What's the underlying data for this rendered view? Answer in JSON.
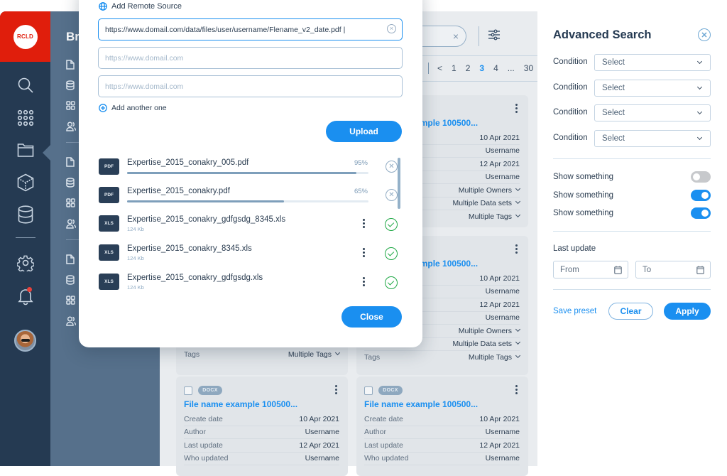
{
  "sidebar": {
    "logo_text": "RCLD",
    "items": [
      {
        "icon": "search-icon"
      },
      {
        "icon": "apps-grid-icon"
      },
      {
        "icon": "folder-icon",
        "active": true
      },
      {
        "icon": "cube-icon"
      },
      {
        "icon": "database-icon"
      },
      {
        "icon": "gear-icon"
      },
      {
        "icon": "bell-icon",
        "notification": true
      },
      {
        "icon": "avatar"
      }
    ]
  },
  "subnav": {
    "title": "Br",
    "groups": [
      [
        "file-icon",
        "database-icon",
        "grid-icon",
        "users-icon"
      ],
      [
        "file-icon",
        "database-icon",
        "grid-icon",
        "users-icon"
      ],
      [
        "file-icon",
        "database-icon",
        "grid-icon",
        "users-icon"
      ]
    ]
  },
  "toolbar": {
    "search_clear": "×",
    "pagination": {
      "prev": "<",
      "pages": [
        "1",
        "2",
        "3",
        "4",
        "...",
        "30"
      ],
      "current": "3"
    }
  },
  "cards": [
    {
      "title": "File name example 100500...",
      "badge": "",
      "rows": [
        {
          "key": "",
          "value": "10 Apr 2021"
        },
        {
          "key": "",
          "value": "Username"
        },
        {
          "key": "",
          "value": "12 Apr 2021"
        },
        {
          "key": "",
          "value": "Username"
        },
        {
          "key": "",
          "value": "Multiple Owners",
          "dropdown": true
        },
        {
          "key": "",
          "value": "Multiple Data sets",
          "dropdown": true
        },
        {
          "key": "",
          "value": "Multiple Tags",
          "dropdown": true
        }
      ]
    },
    {
      "title": "File name example 100500...",
      "badge": "",
      "rows": [
        {
          "key": "",
          "value": "10 Apr 2021"
        },
        {
          "key": "",
          "value": "Username"
        },
        {
          "key": "",
          "value": "12 Apr 2021"
        },
        {
          "key": "",
          "value": "Username"
        },
        {
          "key": "",
          "value": "Multiple Owners",
          "dropdown": true
        },
        {
          "key": "",
          "value": "Multiple Data sets",
          "dropdown": true
        },
        {
          "key": "Tags",
          "value": "Multiple Tags",
          "dropdown": true
        }
      ],
      "left_tags_row": {
        "key": "Tags",
        "value": "Multiple Tags"
      }
    },
    {
      "title": "File name example 100500...",
      "badge": "DOCX",
      "rows": [
        {
          "key": "Create date",
          "value": "10 Apr 2021"
        },
        {
          "key": "Author",
          "value": "Username"
        },
        {
          "key": "Last update",
          "value": "12 Apr 2021"
        },
        {
          "key": "Who updated",
          "value": "Username"
        }
      ]
    },
    {
      "title": "File name example 100500...",
      "badge": "DOCX",
      "rows": [
        {
          "key": "Create date",
          "value": "10 Apr 2021"
        },
        {
          "key": "Author",
          "value": "Username"
        },
        {
          "key": "Last update",
          "value": "12 Apr 2021"
        },
        {
          "key": "Who updated",
          "value": "Username"
        }
      ]
    }
  ],
  "modal": {
    "heading": "Add Remote Source",
    "url_fields": [
      {
        "value": "https://www.domail.com/data/files/user/username/Flename_v2_date.pdf |",
        "placeholder": ""
      },
      {
        "value": "",
        "placeholder": "https://www.domail.com"
      },
      {
        "value": "",
        "placeholder": "https://www.domail.com"
      }
    ],
    "add_another": "Add another one",
    "upload_label": "Upload",
    "close_label": "Close",
    "files": [
      {
        "type": "PDF",
        "name": "Expertise_2015_conakry_005.pdf",
        "progress": 95,
        "progress_label": "95%",
        "status": "uploading"
      },
      {
        "type": "PDF",
        "name": "Expertise_2015_conakry.pdf",
        "progress": 65,
        "progress_label": "65%",
        "status": "uploading"
      },
      {
        "type": "XLS",
        "name": "Expertise_2015_conakry_gdfgsdg_8345.xls",
        "size": "124 Kb",
        "status": "done"
      },
      {
        "type": "XLS",
        "name": "Expertise_2015_conakry_8345.xls",
        "size": "124 Kb",
        "status": "done"
      },
      {
        "type": "XLS",
        "name": "Expertise_2015_conakry_gdfgsdg.xls",
        "size": "124 Kb",
        "status": "done"
      }
    ]
  },
  "advanced_search": {
    "title": "Advanced Search",
    "conditions": [
      {
        "label": "Condition",
        "value": "Select"
      },
      {
        "label": "Condition",
        "value": "Select"
      },
      {
        "label": "Condition",
        "value": "Select"
      },
      {
        "label": "Condition",
        "value": "Select"
      }
    ],
    "toggles": [
      {
        "label": "Show something",
        "on": false
      },
      {
        "label": "Show something",
        "on": true
      },
      {
        "label": "Show something",
        "on": true
      }
    ],
    "last_update_label": "Last update",
    "from_placeholder": "From",
    "to_placeholder": "To",
    "save_preset": "Save preset",
    "clear": "Clear",
    "apply": "Apply"
  },
  "colors": {
    "accent": "#1a8ff0",
    "brand_red": "#e01e0c",
    "rail": "#253a52",
    "subnav": "#56708b",
    "success": "#1fa845"
  }
}
